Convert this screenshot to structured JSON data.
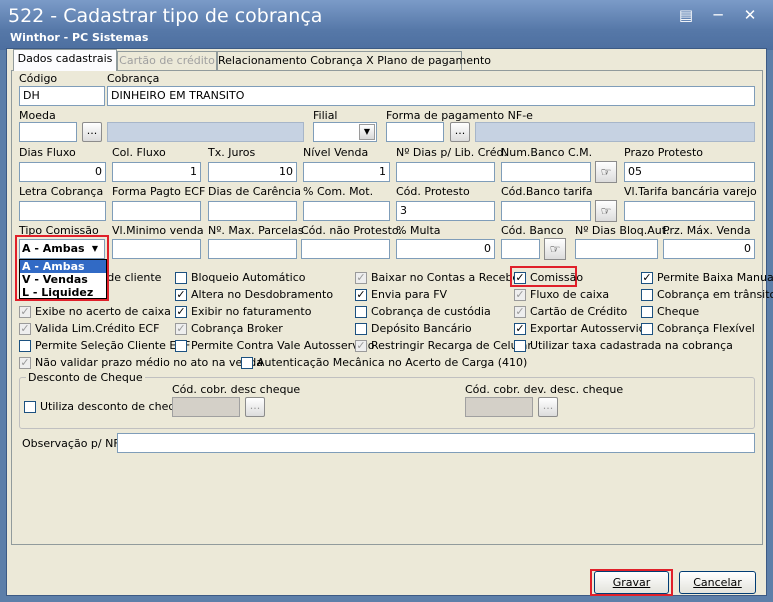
{
  "window": {
    "title": "522 - Cadastrar tipo de cobrança",
    "subtitle": "Winthor - PC Sistemas"
  },
  "tabs": [
    {
      "label": "Dados cadastrais"
    },
    {
      "label": "Cartão de crédito"
    },
    {
      "label": "Relacionamento Cobrança X Plano de pagamento"
    }
  ],
  "fields": {
    "codigo": {
      "label": "Código",
      "value": "DH"
    },
    "cobranca": {
      "label": "Cobrança",
      "value": "DINHEIRO EM TRANSITO"
    },
    "moeda": {
      "label": "Moeda",
      "value": ""
    },
    "filial": {
      "label": "Filial",
      "value": ""
    },
    "forma_pagamento_nfe": {
      "label": "Forma de pagamento NF-e",
      "value": ""
    },
    "dias_fluxo": {
      "label": "Dias Fluxo",
      "value": "0"
    },
    "col_fluxo": {
      "label": "Col. Fluxo",
      "value": "1"
    },
    "tx_juros": {
      "label": "Tx. Juros",
      "value": "10"
    },
    "nivel_venda": {
      "label": "Nível Venda",
      "value": "1"
    },
    "dias_lib_cred": {
      "label": "Nº Dias p/ Lib. Créd.",
      "value": ""
    },
    "num_banco_cm": {
      "label": "Num.Banco C.M.",
      "value": ""
    },
    "prazo_protesto": {
      "label": "Prazo Protesto",
      "value": "05"
    },
    "letra_cobranca": {
      "label": "Letra Cobrança",
      "value": ""
    },
    "forma_pagto_ecf": {
      "label": "Forma Pagto ECF",
      "value": ""
    },
    "dias_carencia": {
      "label": "Dias de Carência",
      "value": ""
    },
    "com_mot": {
      "label": "% Com. Mot.",
      "value": ""
    },
    "cod_protesto": {
      "label": "Cód. Protesto",
      "value": "3"
    },
    "cod_banco_tarifa": {
      "label": "Cód.Banco tarifa",
      "value": ""
    },
    "vl_tarifa_bancaria": {
      "label": "Vl.Tarifa bancária varejo",
      "value": ""
    },
    "tipo_comissao": {
      "label": "Tipo Comissão",
      "value": "A - Ambas"
    },
    "vl_minimo_venda": {
      "label": "Vl.Minimo venda",
      "value": ""
    },
    "max_parcelas": {
      "label": "Nº. Max. Parcelas",
      "value": ""
    },
    "cod_nao_protesto": {
      "label": "Cód. não Protesto.",
      "value": ""
    },
    "multa": {
      "label": "% Multa",
      "value": "0"
    },
    "cod_banco": {
      "label": "Cód. Banco",
      "value": ""
    },
    "dias_bloq_aut": {
      "label": "Nº Dias Bloq.Aut.",
      "value": ""
    },
    "prz_max_venda": {
      "label": "Prz. Máx. Venda",
      "value": "0"
    }
  },
  "tipo_comissao_options": [
    "A - Ambas",
    "V - Vendas",
    "L - Liquidez"
  ],
  "checkboxes": {
    "c1": [
      {
        "label": "o de cliente",
        "checked": false,
        "gray": false
      },
      {
        "label": "",
        "checked": false,
        "gray": false
      },
      {
        "label": "Exibe no acerto de caixa",
        "checked": true,
        "gray": true
      },
      {
        "label": "Valida Lim.Crédito ECF",
        "checked": true,
        "gray": true
      },
      {
        "label": "Permite Seleção Cliente ECF",
        "checked": false,
        "gray": false
      },
      {
        "label": "Não validar prazo médio no ato na venda",
        "checked": true,
        "gray": true
      }
    ],
    "c2": [
      {
        "label": "Bloqueio Automático",
        "checked": false,
        "gray": false
      },
      {
        "label": "Altera no Desdobramento",
        "checked": true,
        "gray": false
      },
      {
        "label": "Exibir no faturamento",
        "checked": true,
        "gray": false
      },
      {
        "label": "Cobrança Broker",
        "checked": true,
        "gray": true
      },
      {
        "label": "Permite Contra Vale Autosserviço",
        "checked": false,
        "gray": false
      },
      {
        "label": "Autenticação Mecânica no Acerto de Carga (410)",
        "checked": false,
        "gray": false
      }
    ],
    "c3": [
      {
        "label": "Baixar no Contas a Receber",
        "checked": true,
        "gray": true
      },
      {
        "label": "Envia para FV",
        "checked": true,
        "gray": false
      },
      {
        "label": "Cobrança de custódia",
        "checked": false,
        "gray": false
      },
      {
        "label": "Depósito Bancário",
        "checked": false,
        "gray": false
      },
      {
        "label": "Restringir Recarga de Celular",
        "checked": true,
        "gray": true
      }
    ],
    "c4": [
      {
        "label": "Comissão",
        "checked": true,
        "gray": false
      },
      {
        "label": "Fluxo de caixa",
        "checked": true,
        "gray": true
      },
      {
        "label": "Cartão de Crédito",
        "checked": true,
        "gray": true
      },
      {
        "label": "Exportar Autosserviço",
        "checked": true,
        "gray": false
      },
      {
        "label": "Utilizar taxa cadastrada na cobrança",
        "checked": false,
        "gray": false
      }
    ],
    "c5": [
      {
        "label": "Permite Baixa Manual",
        "checked": true,
        "gray": false
      },
      {
        "label": "Cobrança em trânsito",
        "checked": false,
        "gray": false
      },
      {
        "label": "Cheque",
        "checked": false,
        "gray": false
      },
      {
        "label": "Cobrança Flexível",
        "checked": false,
        "gray": false
      }
    ]
  },
  "desconto_cheque": {
    "legend": "Desconto de Cheque",
    "utiliza_label": "Utiliza desconto de cheque",
    "cod_desc_label": "Cód. cobr. desc cheque",
    "cod_dev_label": "Cód. cobr. dev. desc. cheque"
  },
  "observacao": {
    "label": "Observação p/ NF:",
    "value": ""
  },
  "buttons": {
    "gravar": "Gravar",
    "cancelar": "Cancelar",
    "dots": "..."
  },
  "icons": {
    "restore": "restore-icon",
    "minimize": "minimize-icon",
    "close": "close-icon",
    "hand": "pointing-hand-icon"
  },
  "colors": {
    "highlight": "#e0202a",
    "titlebar": "#5678a8",
    "selection": "#316ac5"
  }
}
